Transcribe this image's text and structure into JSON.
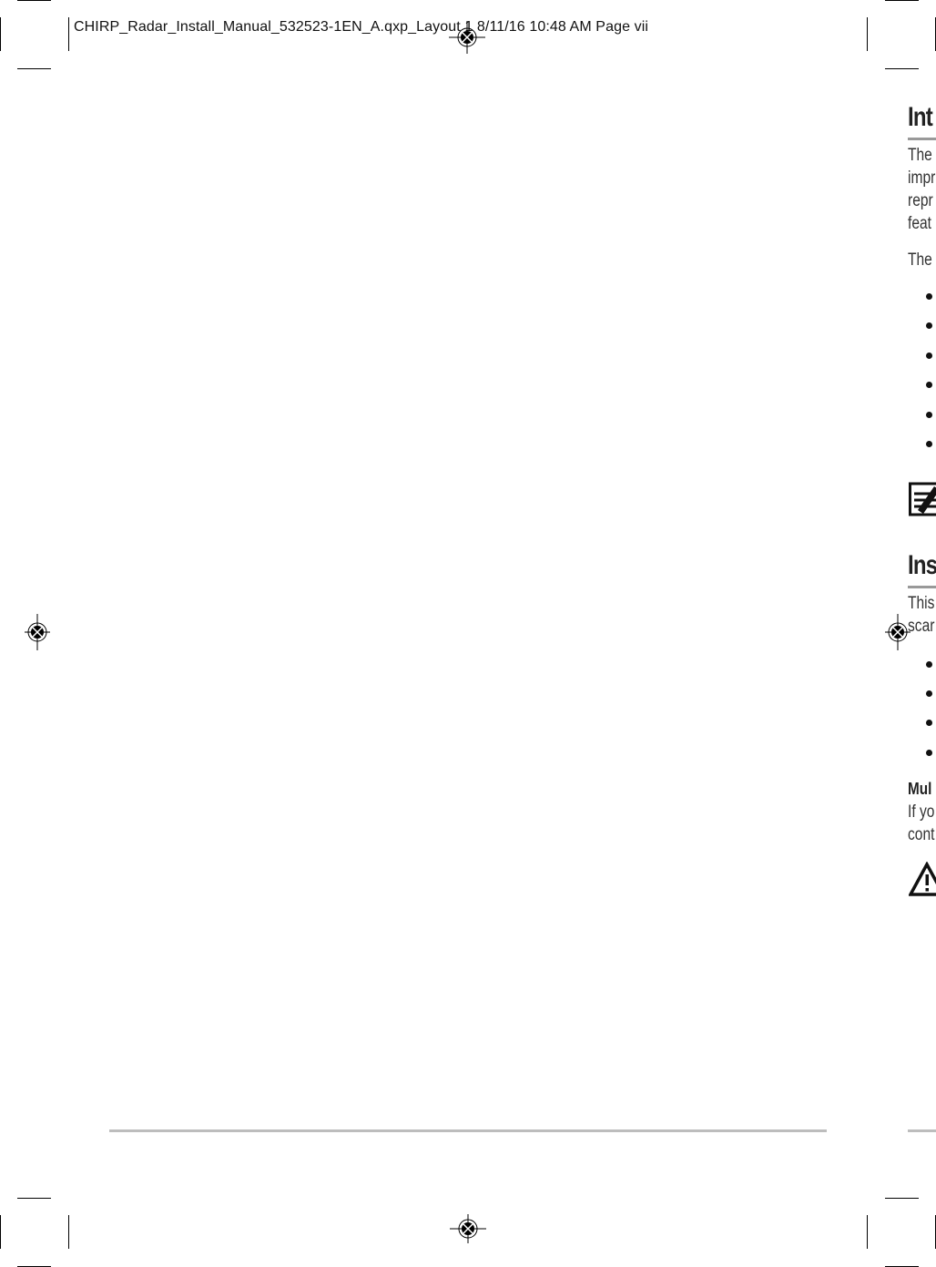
{
  "slug": {
    "text": "CHIRP_Radar_Install_Manual_532523-1EN_A.qxp_Layout 1  8/11/16  10:48 AM  Page vii"
  },
  "right_column_fragments": {
    "heading1": "Int",
    "para1": [
      "The",
      "impr",
      "repr",
      "feat"
    ],
    "para2": "The",
    "bullets1_count": 6,
    "note_icon": "note-pencil-icon",
    "heading2": "Ins",
    "para3": [
      "This",
      "scar"
    ],
    "bullets2_count": 4,
    "subheading": "Mul",
    "para4": [
      "If yo",
      "cont"
    ],
    "warning_icon": "warning-triangle-icon"
  },
  "colors": {
    "rule_gray": "#bdbdbd",
    "heading_rule": "#999999",
    "text": "#333333"
  }
}
